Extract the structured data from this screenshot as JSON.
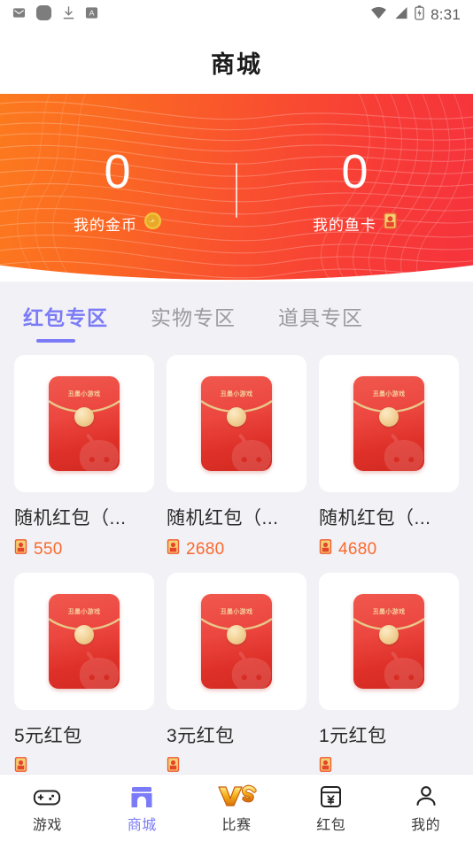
{
  "status_bar": {
    "time": "8:31",
    "left_icons": [
      "mail-icon",
      "rounded-square-icon",
      "download-icon",
      "a-badge-icon"
    ],
    "right_icons": [
      "wifi-icon",
      "signal-icon",
      "battery-icon"
    ]
  },
  "header": {
    "title": "商城"
  },
  "banner": {
    "gradient_from": "#FC7A1E",
    "gradient_to": "#F5333C",
    "stats": [
      {
        "value": "0",
        "label": "我的金币",
        "icon": "gold-coin-icon"
      },
      {
        "value": "0",
        "label": "我的鱼卡",
        "icon": "fish-card-icon"
      }
    ]
  },
  "tabs": {
    "active_color": "#7B7BF7",
    "items": [
      {
        "label": "红包专区",
        "active": true
      },
      {
        "label": "实物专区",
        "active": false
      },
      {
        "label": "道具专区",
        "active": false
      }
    ]
  },
  "products": {
    "price_color": "#F96A2E",
    "envelope_brand": "丑墨小游戏",
    "items": [
      {
        "name": "随机红包（...",
        "price": "550",
        "price_icon": "fish-card-icon",
        "image": "red-envelope-image"
      },
      {
        "name": "随机红包（...",
        "price": "2680",
        "price_icon": "fish-card-icon",
        "image": "red-envelope-image"
      },
      {
        "name": "随机红包（...",
        "price": "4680",
        "price_icon": "fish-card-icon",
        "image": "red-envelope-image"
      },
      {
        "name": "5元红包",
        "price": "",
        "price_icon": "fish-card-icon",
        "image": "red-envelope-image"
      },
      {
        "name": "3元红包",
        "price": "",
        "price_icon": "fish-card-icon",
        "image": "red-envelope-image"
      },
      {
        "name": "1元红包",
        "price": "",
        "price_icon": "fish-card-icon",
        "image": "red-envelope-image"
      }
    ]
  },
  "bottom_nav": {
    "active_color": "#7B7BF7",
    "items": [
      {
        "label": "游戏",
        "icon": "gamepad-icon",
        "active": false
      },
      {
        "label": "商城",
        "icon": "store-icon",
        "active": true
      },
      {
        "label": "比赛",
        "icon": "vs-icon",
        "active": false
      },
      {
        "label": "红包",
        "icon": "red-packet-icon",
        "active": false
      },
      {
        "label": "我的",
        "icon": "person-icon",
        "active": false
      }
    ]
  }
}
